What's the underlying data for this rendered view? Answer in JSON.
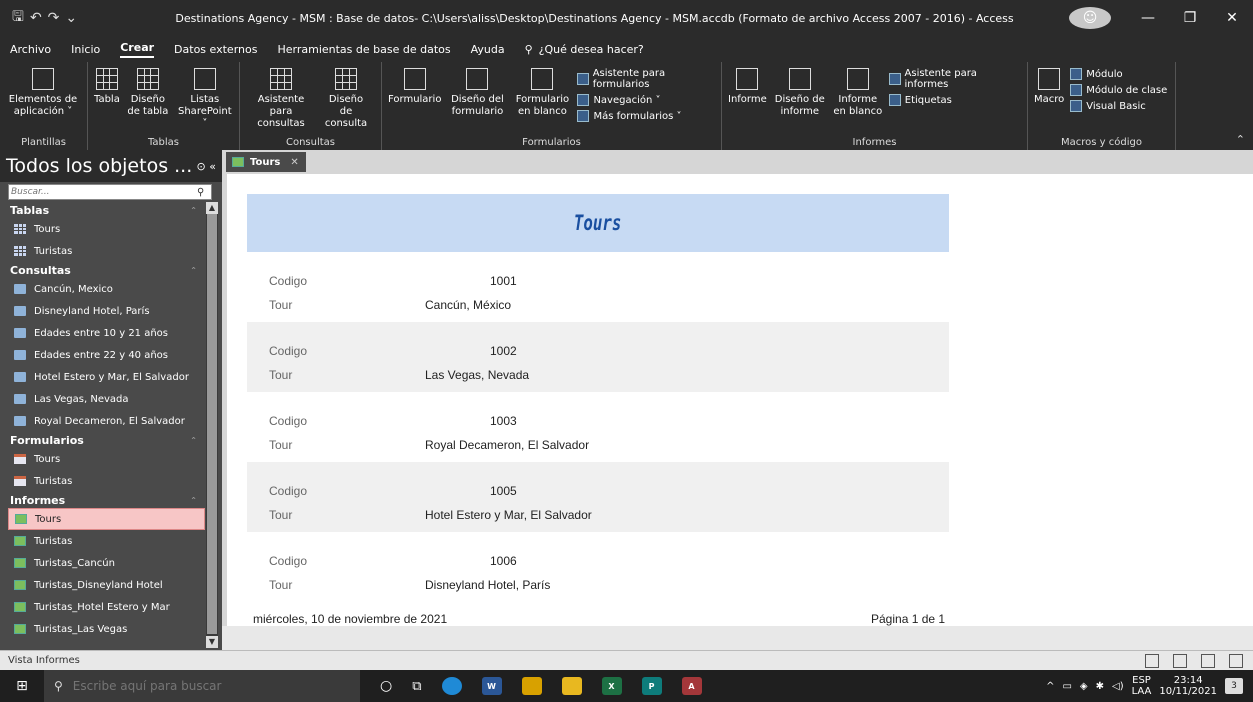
{
  "window": {
    "title": "Destinations Agency - MSM : Base de datos- C:\\Users\\aliss\\Desktop\\Destinations Agency - MSM.accdb (Formato de archivo Access 2007 - 2016)  -  Access"
  },
  "menu": {
    "tabs": [
      "Archivo",
      "Inicio",
      "Crear",
      "Datos externos",
      "Herramientas de base de datos",
      "Ayuda"
    ],
    "active": "Crear",
    "search_placeholder": "¿Qué desea hacer?"
  },
  "ribbon": {
    "groups": {
      "plantillas": {
        "label": "Plantillas",
        "buttons": [
          "Elementos de aplicación ˅"
        ]
      },
      "tablas": {
        "label": "Tablas",
        "buttons": [
          "Tabla",
          "Diseño de tabla",
          "Listas SharePoint ˅"
        ]
      },
      "consultas": {
        "label": "Consultas",
        "buttons": [
          "Asistente para consultas",
          "Diseño de consulta"
        ]
      },
      "formularios": {
        "label": "Formularios",
        "buttons": [
          "Formulario",
          "Diseño del formulario",
          "Formulario en blanco"
        ],
        "small": [
          "Asistente para formularios",
          "Navegación ˅",
          "Más formularios ˅"
        ]
      },
      "informes": {
        "label": "Informes",
        "buttons": [
          "Informe",
          "Diseño de informe",
          "Informe en blanco"
        ],
        "small": [
          "Asistente para informes",
          "Etiquetas"
        ]
      },
      "macros": {
        "label": "Macros y código",
        "buttons": [
          "Macro"
        ],
        "small": [
          "Módulo",
          "Módulo de clase",
          "Visual Basic"
        ]
      }
    }
  },
  "nav": {
    "header": "Todos los objetos ...",
    "search_placeholder": "Buscar...",
    "categories": [
      {
        "name": "Tablas",
        "type": "table",
        "items": [
          "Tours",
          "Turistas"
        ]
      },
      {
        "name": "Consultas",
        "type": "query",
        "items": [
          "Cancún, Mexico",
          "Disneyland Hotel, París",
          "Edades entre 10 y 21 años",
          "Edades entre 22 y 40 años",
          "Hotel Estero y Mar, El Salvador",
          "Las Vegas, Nevada",
          "Royal Decameron, El Salvador"
        ]
      },
      {
        "name": "Formularios",
        "type": "form",
        "items": [
          "Tours",
          "Turistas"
        ]
      },
      {
        "name": "Informes",
        "type": "report",
        "items": [
          "Tours",
          "Turistas",
          "Turistas_Cancún",
          "Turistas_Disneyland Hotel",
          "Turistas_Hotel Estero y Mar",
          "Turistas_Las Vegas"
        ]
      }
    ],
    "selected": "Informes/Tours"
  },
  "document": {
    "tab_label": "Tours",
    "report_title": "Tours",
    "field_labels": {
      "code": "Codigo",
      "tour": "Tour"
    },
    "records": [
      {
        "code": "1001",
        "tour": "Cancún, México"
      },
      {
        "code": "1002",
        "tour": "Las Vegas, Nevada"
      },
      {
        "code": "1003",
        "tour": "Royal Decameron, El Salvador"
      },
      {
        "code": "1005",
        "tour": "Hotel Estero y Mar, El Salvador"
      },
      {
        "code": "1006",
        "tour": "Disneyland Hotel, París"
      }
    ],
    "footer_date": "miércoles, 10 de noviembre de 2021",
    "footer_page": "Página 1 de 1"
  },
  "status": {
    "text": "Vista Informes"
  },
  "taskbar": {
    "search_placeholder": "Escribe aquí para buscar",
    "lang_top": "ESP",
    "lang_bottom": "LAA",
    "time": "23:14",
    "date": "10/11/2021",
    "notifications": "3"
  },
  "colors": {
    "report_header_bg": "#c7daf3",
    "report_title": "#1a4fa0",
    "selected_item_bg": "#f7c6c6"
  }
}
